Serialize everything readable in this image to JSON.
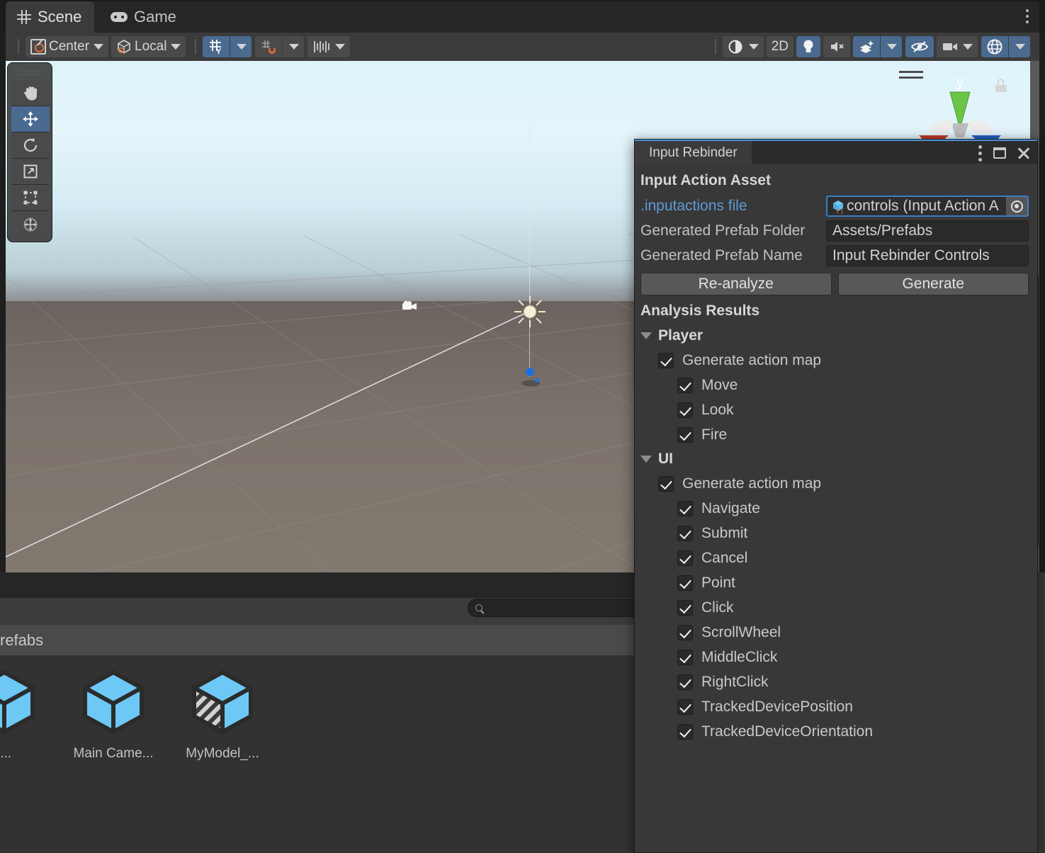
{
  "window": {
    "tabs": [
      {
        "label": "Scene",
        "icon": "grid-icon",
        "active": true
      },
      {
        "label": "Game",
        "icon": "gamepad-icon",
        "active": false
      }
    ],
    "overflow_menu": "kebab-menu-icon"
  },
  "scene_toolbar": {
    "pivot_mode": "Center",
    "handle_space": "Local",
    "grid_axis_label": "Y",
    "draw_mode": "shaded-dropdown",
    "view_2d": "2D",
    "lighting": "light-bulb-toggle",
    "audio": "audio-mute-toggle",
    "effects": "fx-toggle",
    "hidden_objects": "visibility-toggle",
    "camera": "scene-camera-dropdown",
    "gizmos": "gizmos-toggle"
  },
  "scene_tools": [
    {
      "name": "hand-tool",
      "selected": false
    },
    {
      "name": "move-tool",
      "selected": true
    },
    {
      "name": "rotate-tool",
      "selected": false
    },
    {
      "name": "scale-tool",
      "selected": false
    },
    {
      "name": "rect-tool",
      "selected": false
    },
    {
      "name": "transform-tool",
      "selected": false
    }
  ],
  "scene_gizmo": {
    "axis_label": "y",
    "lock_state": "unlocked"
  },
  "project": {
    "breadcrumb": "refabs",
    "search_placeholder": "",
    "search_value": "",
    "assets": [
      {
        "label": "i...",
        "icon": "prefab-cube-icon"
      },
      {
        "label": "Main Came...",
        "icon": "prefab-cube-icon"
      },
      {
        "label": "MyModel_...",
        "icon": "model-prefab-cube-icon"
      }
    ]
  },
  "rebinder": {
    "tab_label": "Input Rebinder",
    "window_buttons": {
      "menu": "kebab-menu-icon",
      "maximize": "maximize-icon",
      "close": "close-icon"
    },
    "section_asset_title": "Input Action Asset",
    "fields": [
      {
        "label": ".inputactions file",
        "label_is_link": true,
        "value": "controls (Input Action A",
        "type": "object",
        "icon": "input-action-asset-icon",
        "picker": "object-picker-icon"
      },
      {
        "label": "Generated Prefab Folder",
        "label_is_link": false,
        "value": "Assets/Prefabs",
        "type": "text"
      },
      {
        "label": "Generated Prefab Name",
        "label_is_link": false,
        "value": "Input Rebinder Controls",
        "type": "text"
      }
    ],
    "buttons": [
      {
        "label": "Re-analyze",
        "name": "re-analyze-button"
      },
      {
        "label": "Generate",
        "name": "generate-button"
      }
    ],
    "results_title": "Analysis Results",
    "groups": [
      {
        "name": "Player",
        "expanded": true,
        "generate_label": "Generate action map",
        "generate_checked": true,
        "actions": [
          {
            "label": "Move",
            "checked": true
          },
          {
            "label": "Look",
            "checked": true
          },
          {
            "label": "Fire",
            "checked": true
          }
        ]
      },
      {
        "name": "UI",
        "expanded": true,
        "generate_label": "Generate action map",
        "generate_checked": true,
        "actions": [
          {
            "label": "Navigate",
            "checked": true
          },
          {
            "label": "Submit",
            "checked": true
          },
          {
            "label": "Cancel",
            "checked": true
          },
          {
            "label": "Point",
            "checked": true
          },
          {
            "label": "Click",
            "checked": true
          },
          {
            "label": "ScrollWheel",
            "checked": true
          },
          {
            "label": "MiddleClick",
            "checked": true
          },
          {
            "label": "RightClick",
            "checked": true
          },
          {
            "label": "TrackedDevicePosition",
            "checked": true
          },
          {
            "label": "TrackedDeviceOrientation",
            "checked": true
          }
        ]
      }
    ]
  },
  "colors": {
    "accent_blue": "#4a6a8f",
    "link_blue": "#5e9bd6",
    "panel_bg": "#383838",
    "toolbar_bg": "#3b3b3b",
    "prefab_cube": "#6ec8f5",
    "pivot_orange": "#e06c3b"
  }
}
